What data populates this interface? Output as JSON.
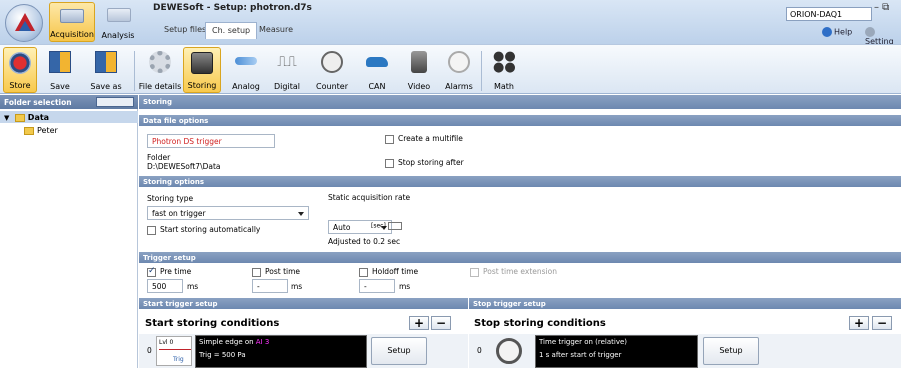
{
  "window": {
    "title": "DEWESoft - Setup: photron.d7s",
    "device": "ORION-DAQ1",
    "controls": "– ⧉"
  },
  "modes": {
    "acquisition": "Acquisition",
    "analysis": "Analysis"
  },
  "tabs": {
    "setup_files": "Setup files",
    "ch_setup": "Ch. setup",
    "measure": "Measure"
  },
  "help": {
    "help": "Help",
    "settings": "Setting"
  },
  "ribbon": {
    "store": "Store",
    "save": "Save",
    "save_as": "Save as",
    "file_details": "File details",
    "storing": "Storing",
    "analog": "Analog",
    "digital": "Digital",
    "counter": "Counter",
    "can": "CAN",
    "video": "Video",
    "alarms": "Alarms",
    "math": "Math"
  },
  "left": {
    "header": "Folder selection",
    "tree": [
      {
        "label": "Data"
      },
      {
        "label": "Peter"
      }
    ]
  },
  "main": {
    "header": "Storing",
    "data_file_options": "Data file options",
    "filename": "Photron DS trigger",
    "create_multifile": "Create a multifile",
    "folder_label": "Folder",
    "folder_path": "D:\\DEWESoft7\\Data",
    "stop_storing_after": "Stop storing after",
    "storing_options": "Storing options",
    "storing_type_label": "Storing type",
    "storing_type_value": "fast on trigger",
    "start_auto": "Start storing automatically",
    "static_rate_label": "Static acquisition rate",
    "static_rate_value": "Auto",
    "unit_sec": "[sec]",
    "adjusted": "Adjusted to 0.2 sec",
    "trigger_setup": "Trigger setup",
    "pre_time": "Pre time",
    "pre_time_value": "500",
    "pre_unit": "ms",
    "post_time": "Post time",
    "post_time_value": "-",
    "post_unit": "ms",
    "holdoff_time": "Holdoff time",
    "holdoff_value": "-",
    "holdoff_unit": "ms",
    "post_time_extension": "Post time extension",
    "start_trigger_setup": "Start trigger setup",
    "stop_trigger_setup": "Stop trigger setup",
    "start_conditions": "Start storing conditions",
    "stop_conditions": "Stop storing conditions",
    "plus": "+",
    "minus": "−",
    "start_cond": {
      "index": "0",
      "lvl": "Lvl 0",
      "trig": "Trig",
      "line1_a": "Simple edge on ",
      "line1_b": "AI 3",
      "line2": "Trig = 500 Pa",
      "setup": "Setup"
    },
    "stop_cond": {
      "index": "0",
      "line1": "Time trigger on  (relative)",
      "line2": "1 s after start of trigger",
      "setup": "Setup"
    }
  },
  "colors": {
    "accent": "#f6c548",
    "header": "#6d88b0",
    "channel_highlight": "#ff33ff",
    "filename_red": "#d02020"
  }
}
